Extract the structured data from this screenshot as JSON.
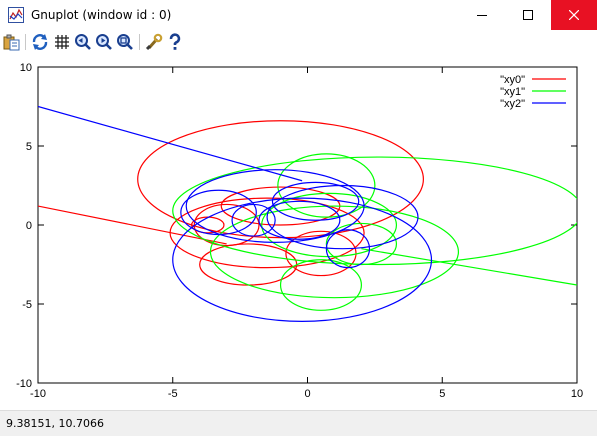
{
  "window": {
    "title": "Gnuplot (window id : 0)"
  },
  "toolbar": {
    "buttons": [
      {
        "name": "copy-to-clipboard-icon"
      },
      {
        "name": "replot-icon"
      },
      {
        "name": "grid-icon"
      },
      {
        "name": "zoom-previous-icon"
      },
      {
        "name": "zoom-next-icon"
      },
      {
        "name": "autoscale-icon"
      },
      {
        "name": "options-icon"
      },
      {
        "name": "help-icon"
      }
    ]
  },
  "status": {
    "coords": "9.38151,  10.7066"
  },
  "chart_data": {
    "type": "line",
    "title": "",
    "xlabel": "",
    "ylabel": "",
    "xlim": [
      -10,
      10
    ],
    "ylim": [
      -10,
      10
    ],
    "xticks": [
      "-10",
      "-5",
      "0",
      "5",
      "10"
    ],
    "yticks": [
      "-10",
      "-5",
      "0",
      "5",
      "10"
    ],
    "grid": false,
    "legend": "top-right",
    "colors": {
      "xy0": "#ff0000",
      "xy1": "#00ff00",
      "xy2": "#0000ff"
    },
    "series": [
      {
        "name": "\"xy0\"",
        "color": "#ff0000",
        "shape": "closed loops with tail",
        "tail": [
          [
            -10,
            1.2
          ],
          [
            -3,
            -1.2
          ]
        ],
        "loops": [
          [
            -1,
            2.9,
            5.3,
            3.7
          ],
          [
            -1.5,
            -0.5,
            3.6,
            2.2
          ],
          [
            -3,
            0,
            1.2,
            1.3
          ],
          [
            -2.2,
            -2.5,
            1.8,
            1.3
          ],
          [
            0.5,
            -1.8,
            1.3,
            1.4
          ],
          [
            -1,
            1.2,
            2.2,
            1.2
          ],
          [
            -3.7,
            0,
            0.6,
            0.5
          ]
        ]
      },
      {
        "name": "\"xy1\"",
        "color": "#00ff00",
        "shape": "closed loops with tail",
        "tail": [
          [
            2,
            -1.5
          ],
          [
            10,
            -3.8
          ]
        ],
        "loops": [
          [
            2.6,
            0.9,
            7.6,
            3.4
          ],
          [
            1,
            -1.7,
            4.6,
            2.9
          ],
          [
            0.7,
            2.5,
            1.8,
            2.0
          ],
          [
            0.8,
            0,
            2.5,
            2.0
          ],
          [
            0.5,
            -3.8,
            1.5,
            1.6
          ],
          [
            2,
            -1.2,
            1.3,
            1.3
          ]
        ]
      },
      {
        "name": "\"xy2\"",
        "color": "#0000ff",
        "shape": "closed loops with tail",
        "tail": [
          [
            -10,
            7.5
          ],
          [
            -0.2,
            2.8
          ]
        ],
        "loops": [
          [
            -0.2,
            -2.2,
            4.8,
            3.9
          ],
          [
            -1.2,
            1.2,
            3.3,
            2.3
          ],
          [
            1.3,
            0.5,
            2.8,
            2.0
          ],
          [
            -3.3,
            0.8,
            1.4,
            1.4
          ],
          [
            -0.3,
            0.3,
            1.5,
            1.2
          ],
          [
            0.3,
            1.5,
            1.6,
            1.2
          ],
          [
            -2,
            0.3,
            0.8,
            1.0
          ],
          [
            1.5,
            -1.5,
            0.8,
            1.2
          ]
        ]
      }
    ]
  }
}
